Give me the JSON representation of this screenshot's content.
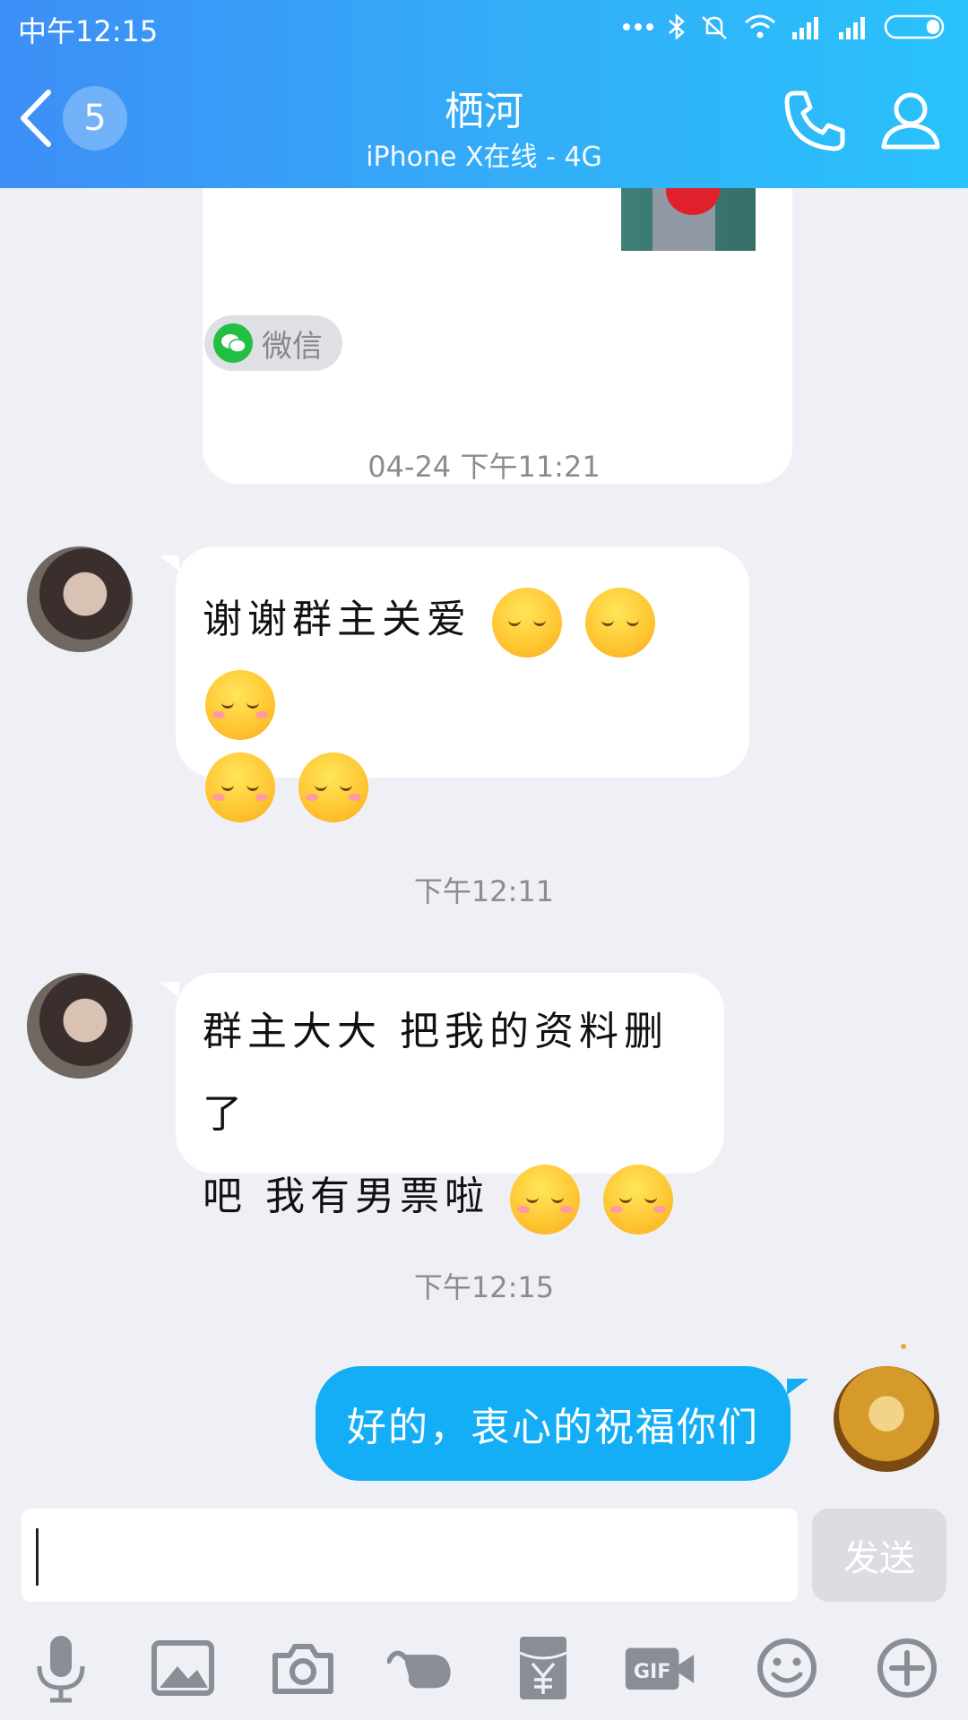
{
  "status_bar": {
    "time": "中午12:15"
  },
  "header": {
    "unread_count": "5",
    "title": "栖河",
    "subtitle": "iPhone X在线 - 4G"
  },
  "messages": {
    "share_card_text": "...",
    "source_label": "微信",
    "ts1": "04-24 下午11:21",
    "msg1_text": "谢谢群主关爱",
    "ts2": "下午12:11",
    "msg2_line1": "群主大大 把我的资料删了",
    "msg2_line2": "吧 我有男票啦",
    "ts3": "下午12:15",
    "my_msg": "好的，衷心的祝福你们"
  },
  "input": {
    "value": "",
    "send_label": "发送"
  },
  "toolbar": {
    "gif_label": "GIF"
  },
  "colors": {
    "header_start": "#3d8ef6",
    "header_end": "#29c2fb",
    "my_bubble": "#14aef6",
    "background": "#eff0f5"
  },
  "icons": [
    "back-icon",
    "phone-icon",
    "profile-icon",
    "mic-icon",
    "image-icon",
    "camera-icon",
    "hand-icon",
    "red-packet-icon",
    "gif-icon",
    "emoji-icon",
    "plus-icon"
  ]
}
